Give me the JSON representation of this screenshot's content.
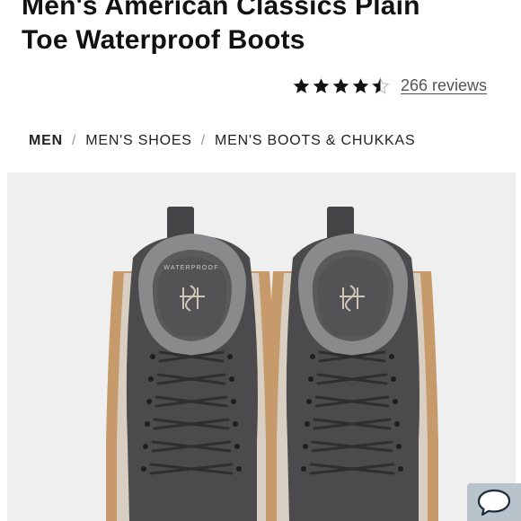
{
  "product": {
    "title_line1": "Men's American Classics Plain",
    "title_line2": "Toe Waterproof Boots",
    "rating": 4.5,
    "rating_max": 5,
    "reviews_label": "266 reviews"
  },
  "breadcrumb": {
    "items": [
      "MEN",
      "MEN'S SHOES",
      "MEN'S BOOTS & CHUKKAS"
    ],
    "separator": "/"
  },
  "image": {
    "tongue_text": "WATERPROOF",
    "logo_mark": "ꟸG",
    "colors": {
      "leather": "#4b4b4d",
      "collar": "#8a8a8c",
      "sole": "#c79a6b",
      "background": "#efefef"
    }
  },
  "chat": {
    "icon": "chat-bubble-icon"
  }
}
